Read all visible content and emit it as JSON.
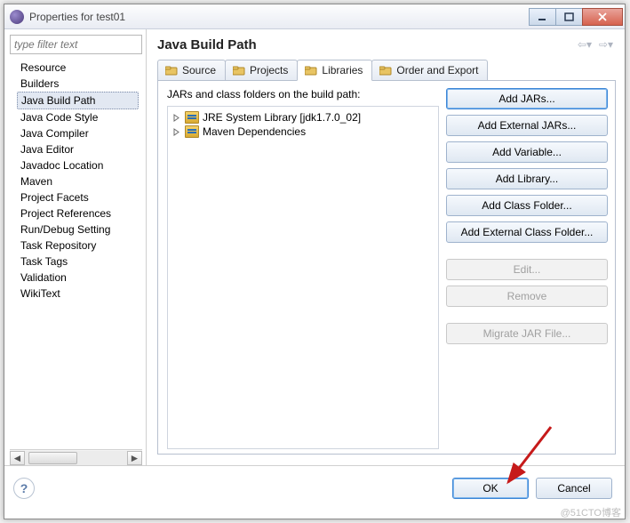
{
  "window": {
    "title": "Properties for test01"
  },
  "sidebar": {
    "filter_placeholder": "type filter text",
    "items": [
      "Resource",
      "Builders",
      "Java Build Path",
      "Java Code Style",
      "Java Compiler",
      "Java Editor",
      "Javadoc Location",
      "Maven",
      "Project Facets",
      "Project References",
      "Run/Debug Setting",
      "Task Repository",
      "Task Tags",
      "Validation",
      "WikiText"
    ],
    "selected_index": 2
  },
  "main": {
    "title": "Java Build Path",
    "tabs": [
      {
        "label": "Source"
      },
      {
        "label": "Projects"
      },
      {
        "label": "Libraries"
      },
      {
        "label": "Order and Export"
      }
    ],
    "active_tab": 2,
    "desc": "JARs and class folders on the build path:",
    "jars": [
      {
        "label": "JRE System Library [jdk1.7.0_02]",
        "highlighted": true
      },
      {
        "label": "Maven Dependencies",
        "highlighted": false
      }
    ],
    "buttons": {
      "add_jars": "Add JARs...",
      "add_ext_jars": "Add External JARs...",
      "add_variable": "Add Variable...",
      "add_library": "Add Library...",
      "add_class_folder": "Add Class Folder...",
      "add_ext_class_folder": "Add External Class Folder...",
      "edit": "Edit...",
      "remove": "Remove",
      "migrate": "Migrate JAR File..."
    }
  },
  "footer": {
    "ok": "OK",
    "cancel": "Cancel"
  },
  "watermark": "@51CTO博客"
}
